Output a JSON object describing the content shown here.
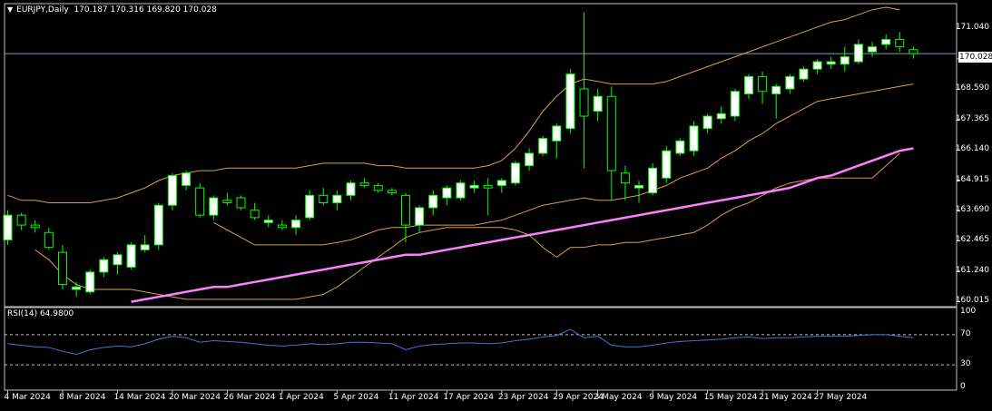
{
  "header": {
    "symbol": "EURJPY,Daily",
    "ohlc": "170.187 170.316 169.820 170.028"
  },
  "current_price": "170.028",
  "price_axis": [
    "171.040",
    "169.815",
    "168.590",
    "167.365",
    "166.140",
    "164.915",
    "163.690",
    "162.465",
    "161.240",
    "160.015"
  ],
  "rsi": {
    "label": "RSI(14) 64.9800",
    "axis": [
      "100",
      "70",
      "30",
      "0"
    ],
    "levels": [
      70,
      30
    ]
  },
  "date_axis": [
    "4 Mar 2024",
    "8 Mar 2024",
    "14 Mar 2024",
    "20 Mar 2024",
    "26 Mar 2024",
    "1 Apr 2024",
    "5 Apr 2024",
    "11 Apr 2024",
    "17 Apr 2024",
    "23 Apr 2024",
    "29 Apr 2024",
    "3 May 2024",
    "9 May 2024",
    "15 May 2024",
    "21 May 2024",
    "27 May 2024"
  ],
  "colors": {
    "background": "#000000",
    "bull_candle": "#ffffff",
    "bear_candle": "#000000",
    "wick": "#00ff00",
    "bollinger": "#d4a04c",
    "moving_average": "#ff80ff",
    "rsi_line": "#3c78d8",
    "grid_frame": "#c0c0c0"
  },
  "chart_data": {
    "type": "candlestick",
    "symbol": "EURJPY",
    "timeframe": "Daily",
    "ylim": [
      159.95,
      171.9
    ],
    "candles": [
      {
        "o": 162.5,
        "h": 163.7,
        "l": 162.3,
        "c": 163.5
      },
      {
        "o": 163.5,
        "h": 163.6,
        "l": 162.9,
        "c": 163.1
      },
      {
        "o": 163.1,
        "h": 163.3,
        "l": 162.8,
        "c": 163.0
      },
      {
        "o": 162.8,
        "h": 163.0,
        "l": 162.1,
        "c": 162.2
      },
      {
        "o": 162.0,
        "h": 162.3,
        "l": 160.5,
        "c": 160.7
      },
      {
        "o": 160.5,
        "h": 160.8,
        "l": 160.2,
        "c": 160.6
      },
      {
        "o": 160.4,
        "h": 161.3,
        "l": 160.3,
        "c": 161.2
      },
      {
        "o": 161.2,
        "h": 161.8,
        "l": 161.0,
        "c": 161.7
      },
      {
        "o": 161.5,
        "h": 162.0,
        "l": 161.1,
        "c": 161.9
      },
      {
        "o": 161.4,
        "h": 162.4,
        "l": 161.3,
        "c": 162.3
      },
      {
        "o": 162.1,
        "h": 162.7,
        "l": 162.0,
        "c": 162.3
      },
      {
        "o": 162.3,
        "h": 164.0,
        "l": 162.1,
        "c": 163.9
      },
      {
        "o": 163.9,
        "h": 165.2,
        "l": 163.7,
        "c": 165.1
      },
      {
        "o": 164.7,
        "h": 165.3,
        "l": 164.5,
        "c": 165.2
      },
      {
        "o": 164.6,
        "h": 164.8,
        "l": 163.4,
        "c": 163.5
      },
      {
        "o": 163.5,
        "h": 164.3,
        "l": 163.3,
        "c": 164.2
      },
      {
        "o": 164.1,
        "h": 164.4,
        "l": 163.9,
        "c": 164.0
      },
      {
        "o": 164.2,
        "h": 164.3,
        "l": 163.7,
        "c": 163.8
      },
      {
        "o": 163.7,
        "h": 164.0,
        "l": 163.3,
        "c": 163.4
      },
      {
        "o": 163.2,
        "h": 163.5,
        "l": 163.0,
        "c": 163.3
      },
      {
        "o": 163.1,
        "h": 163.3,
        "l": 162.9,
        "c": 163.0
      },
      {
        "o": 163.0,
        "h": 163.5,
        "l": 162.7,
        "c": 163.3
      },
      {
        "o": 163.4,
        "h": 164.5,
        "l": 163.3,
        "c": 164.3
      },
      {
        "o": 164.3,
        "h": 164.6,
        "l": 163.9,
        "c": 164.0
      },
      {
        "o": 164.0,
        "h": 164.5,
        "l": 163.7,
        "c": 164.3
      },
      {
        "o": 164.3,
        "h": 164.9,
        "l": 164.1,
        "c": 164.8
      },
      {
        "o": 164.8,
        "h": 165.0,
        "l": 164.6,
        "c": 164.7
      },
      {
        "o": 164.7,
        "h": 164.8,
        "l": 164.4,
        "c": 164.5
      },
      {
        "o": 164.5,
        "h": 164.6,
        "l": 164.3,
        "c": 164.4
      },
      {
        "o": 164.3,
        "h": 164.4,
        "l": 162.4,
        "c": 163.1
      },
      {
        "o": 163.1,
        "h": 163.9,
        "l": 162.8,
        "c": 163.8
      },
      {
        "o": 163.8,
        "h": 164.5,
        "l": 163.5,
        "c": 164.3
      },
      {
        "o": 164.2,
        "h": 164.7,
        "l": 163.9,
        "c": 164.6
      },
      {
        "o": 164.2,
        "h": 164.9,
        "l": 164.1,
        "c": 164.8
      },
      {
        "o": 164.6,
        "h": 164.9,
        "l": 164.4,
        "c": 164.7
      },
      {
        "o": 164.7,
        "h": 165.0,
        "l": 163.5,
        "c": 164.6
      },
      {
        "o": 164.7,
        "h": 165.0,
        "l": 164.4,
        "c": 164.9
      },
      {
        "o": 164.8,
        "h": 165.7,
        "l": 164.7,
        "c": 165.6
      },
      {
        "o": 165.5,
        "h": 166.2,
        "l": 165.3,
        "c": 166.0
      },
      {
        "o": 166.0,
        "h": 166.7,
        "l": 165.9,
        "c": 166.6
      },
      {
        "o": 166.5,
        "h": 167.2,
        "l": 165.8,
        "c": 167.1
      },
      {
        "o": 167.0,
        "h": 169.4,
        "l": 166.8,
        "c": 169.2
      },
      {
        "o": 168.6,
        "h": 171.7,
        "l": 165.4,
        "c": 167.5
      },
      {
        "o": 167.7,
        "h": 168.6,
        "l": 167.3,
        "c": 168.3
      },
      {
        "o": 168.3,
        "h": 168.7,
        "l": 164.1,
        "c": 165.3
      },
      {
        "o": 165.2,
        "h": 165.5,
        "l": 164.1,
        "c": 164.8
      },
      {
        "o": 164.6,
        "h": 164.9,
        "l": 164.0,
        "c": 164.7
      },
      {
        "o": 164.4,
        "h": 165.6,
        "l": 164.3,
        "c": 165.4
      },
      {
        "o": 165.0,
        "h": 166.3,
        "l": 164.8,
        "c": 166.1
      },
      {
        "o": 166.0,
        "h": 166.6,
        "l": 165.9,
        "c": 166.5
      },
      {
        "o": 166.1,
        "h": 167.3,
        "l": 165.9,
        "c": 167.1
      },
      {
        "o": 167.0,
        "h": 167.6,
        "l": 166.8,
        "c": 167.5
      },
      {
        "o": 167.4,
        "h": 167.9,
        "l": 167.2,
        "c": 167.6
      },
      {
        "o": 167.5,
        "h": 168.6,
        "l": 167.3,
        "c": 168.5
      },
      {
        "o": 168.4,
        "h": 169.2,
        "l": 168.2,
        "c": 169.1
      },
      {
        "o": 169.1,
        "h": 169.3,
        "l": 168.0,
        "c": 168.5
      },
      {
        "o": 168.4,
        "h": 168.8,
        "l": 167.4,
        "c": 168.7
      },
      {
        "o": 168.6,
        "h": 169.2,
        "l": 168.4,
        "c": 169.1
      },
      {
        "o": 169.0,
        "h": 169.5,
        "l": 168.9,
        "c": 169.4
      },
      {
        "o": 169.4,
        "h": 169.8,
        "l": 169.2,
        "c": 169.7
      },
      {
        "o": 169.6,
        "h": 169.9,
        "l": 169.4,
        "c": 169.7
      },
      {
        "o": 169.6,
        "h": 170.3,
        "l": 169.3,
        "c": 169.9
      },
      {
        "o": 169.7,
        "h": 170.6,
        "l": 169.6,
        "c": 170.4
      },
      {
        "o": 170.1,
        "h": 170.5,
        "l": 169.9,
        "c": 170.3
      },
      {
        "o": 170.4,
        "h": 170.8,
        "l": 170.2,
        "c": 170.6
      },
      {
        "o": 170.6,
        "h": 170.9,
        "l": 170.1,
        "c": 170.3
      },
      {
        "o": 170.187,
        "h": 170.316,
        "l": 169.82,
        "c": 170.028
      }
    ],
    "bollinger_upper": [
      164.3,
      164.1,
      164.1,
      164.0,
      164.0,
      164.0,
      164.0,
      164.1,
      164.2,
      164.4,
      164.6,
      164.9,
      165.1,
      165.2,
      165.3,
      165.3,
      165.4,
      165.4,
      165.4,
      165.4,
      165.4,
      165.4,
      165.5,
      165.6,
      165.6,
      165.6,
      165.6,
      165.5,
      165.5,
      165.4,
      165.4,
      165.4,
      165.4,
      165.4,
      165.4,
      165.5,
      165.7,
      166.2,
      166.9,
      167.7,
      168.3,
      168.8,
      169.0,
      168.9,
      168.8,
      168.8,
      168.8,
      168.8,
      168.9,
      169.1,
      169.3,
      169.5,
      169.7,
      169.9,
      170.1,
      170.3,
      170.5,
      170.7,
      170.9,
      171.1,
      171.3,
      171.4,
      171.6,
      171.8,
      171.9,
      171.8
    ],
    "bollinger_lower": [
      162.1,
      161.7,
      161.1,
      160.7,
      160.5,
      160.5,
      160.5,
      160.5,
      160.4,
      160.3,
      160.2,
      160.1,
      160.1,
      160.1,
      160.1,
      160.1,
      160.1,
      160.1,
      160.1,
      160.1,
      160.2,
      160.3,
      160.6,
      161.0,
      161.4,
      161.8,
      162.2,
      162.6,
      162.8,
      162.9,
      163.0,
      163.0,
      163.0,
      163.0,
      163.0,
      162.9,
      162.7,
      162.2,
      161.8,
      162.2,
      162.2,
      162.3,
      162.3,
      162.4,
      162.4,
      162.5,
      162.6,
      162.7,
      162.8,
      163.1,
      163.5,
      163.8,
      164.0,
      164.3,
      164.6,
      164.8,
      164.9,
      165.0,
      165.0,
      165.0,
      165.0,
      165.0,
      165.5,
      166.0
    ],
    "bollinger_middle": [
      163.2,
      162.9,
      162.6,
      162.3,
      162.3,
      162.3,
      162.3,
      162.3,
      162.3,
      162.4,
      162.5,
      162.7,
      162.9,
      163.0,
      163.0,
      163.1,
      163.1,
      163.1,
      163.1,
      163.1,
      163.2,
      163.3,
      163.5,
      163.7,
      163.9,
      164.0,
      164.1,
      164.2,
      164.1,
      164.1,
      164.2,
      164.3,
      164.5,
      164.7,
      165.0,
      165.2,
      165.4,
      165.8,
      166.1,
      166.5,
      166.8,
      167.2,
      167.5,
      167.8,
      168.1,
      168.2,
      168.3,
      168.4,
      168.5,
      168.6,
      168.7,
      168.8
    ],
    "moving_average": [
      160.0,
      160.1,
      160.2,
      160.3,
      160.4,
      160.5,
      160.6,
      160.6,
      160.7,
      160.8,
      160.9,
      161.0,
      161.1,
      161.2,
      161.3,
      161.4,
      161.5,
      161.6,
      161.7,
      161.8,
      161.9,
      161.9,
      162.0,
      162.1,
      162.2,
      162.3,
      162.4,
      162.5,
      162.6,
      162.7,
      162.8,
      162.9,
      163.0,
      163.1,
      163.2,
      163.3,
      163.4,
      163.5,
      163.6,
      163.7,
      163.8,
      163.9,
      164.0,
      164.1,
      164.2,
      164.3,
      164.4,
      164.5,
      164.6,
      164.8,
      165.0,
      165.1,
      165.3,
      165.5,
      165.7,
      165.9,
      166.1,
      166.2
    ],
    "rsi_values": [
      58,
      56,
      54,
      53,
      48,
      44,
      50,
      53,
      55,
      54,
      58,
      64,
      68,
      66,
      60,
      62,
      61,
      60,
      58,
      56,
      55,
      56,
      58,
      57,
      58,
      60,
      60,
      59,
      58,
      50,
      55,
      57,
      58,
      59,
      59,
      58,
      59,
      62,
      64,
      67,
      69,
      77,
      66,
      68,
      56,
      54,
      54,
      56,
      59,
      61,
      62,
      63,
      64,
      66,
      67,
      65,
      66,
      66,
      67,
      68,
      68,
      68,
      69,
      70,
      70,
      68,
      66
    ]
  }
}
